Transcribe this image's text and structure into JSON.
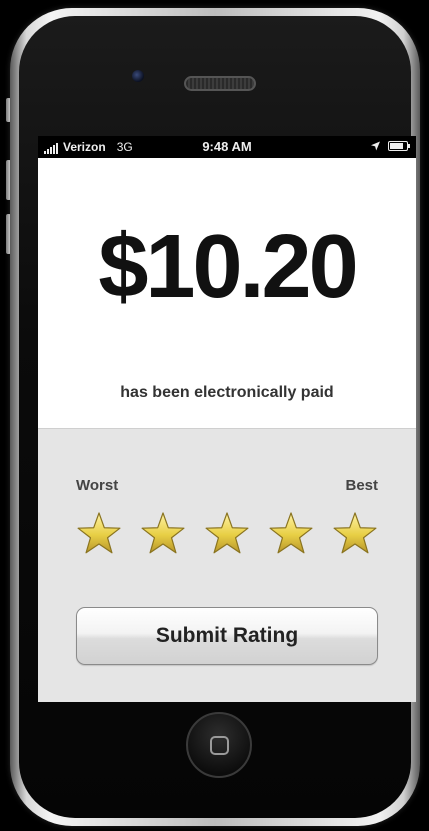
{
  "status_bar": {
    "carrier": "Verizon",
    "network": "3G",
    "time": "9:48 AM",
    "signal_bars": 5,
    "icons": [
      "signal-icon",
      "location-arrow-icon",
      "battery-icon"
    ]
  },
  "payment": {
    "amount": "$10.20",
    "message": "has been electronically paid"
  },
  "rating": {
    "worst_label": "Worst",
    "best_label": "Best",
    "max_stars": 5,
    "filled_stars": 5,
    "star_color": "#e8cf45",
    "submit_label": "Submit Rating"
  },
  "device": {
    "home_button_icon": "home-square-icon"
  }
}
